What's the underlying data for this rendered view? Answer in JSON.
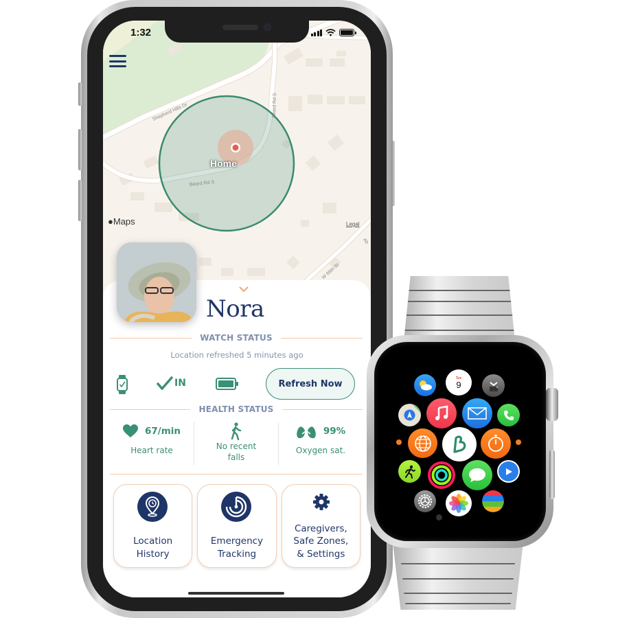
{
  "status_bar": {
    "time": "1:32",
    "signal_bars": 4,
    "battery_level": 1.0
  },
  "map": {
    "provider_label": "Maps",
    "legal_label": "Legal",
    "marker_label": "Home",
    "streets": [
      "Shepherd Hills Dr",
      "Beard Rd S",
      "Beard Rd S",
      "W 88th St",
      "Ab"
    ],
    "colors": {
      "land": "#f7f3ec",
      "park": "#dcecd2",
      "road": "#ffffff",
      "geofence_fill": "#c9e0d3",
      "geofence_stroke": "#3a8a70",
      "marker": "#e8604a"
    }
  },
  "profile": {
    "name": "Nora"
  },
  "watch_status": {
    "heading": "WATCH STATUS",
    "refreshed_text": "Location refreshed 5 minutes ago",
    "zone_status": "IN",
    "refresh_button": "Refresh Now"
  },
  "health_status": {
    "heading": "HEALTH STATUS",
    "metrics": [
      {
        "icon": "heart-icon",
        "value": "67/min",
        "label": "Heart rate"
      },
      {
        "icon": "walking-person-icon",
        "value": "",
        "label": "No recent falls"
      },
      {
        "icon": "lungs-icon",
        "value": "99%",
        "label": "Oxygen sat."
      }
    ]
  },
  "actions": [
    {
      "icon": "location-history-icon",
      "label_lines": [
        "Location",
        "History"
      ]
    },
    {
      "icon": "emergency-tracking-icon",
      "label_lines": [
        "Emergency",
        "Tracking"
      ]
    },
    {
      "icon": "gear-icon",
      "label_lines": [
        "Caregivers,",
        "Safe Zones,",
        "& Settings"
      ]
    }
  ],
  "watch": {
    "calendar": {
      "day": "Tue",
      "date": "9"
    },
    "apps": [
      "weather",
      "calendar",
      "remote",
      "maps",
      "music",
      "mail",
      "phone",
      "timer-left",
      "world-clock",
      "brand-app",
      "stopwatch",
      "timer-right",
      "workout",
      "activity",
      "messages",
      "video-player",
      "settings",
      "photos",
      "passbook",
      "heart-rate"
    ]
  },
  "colors": {
    "navy": "#1f3567",
    "teal": "#3a8f77",
    "peach": "#f3c9aa",
    "muted": "#7f8fae"
  }
}
